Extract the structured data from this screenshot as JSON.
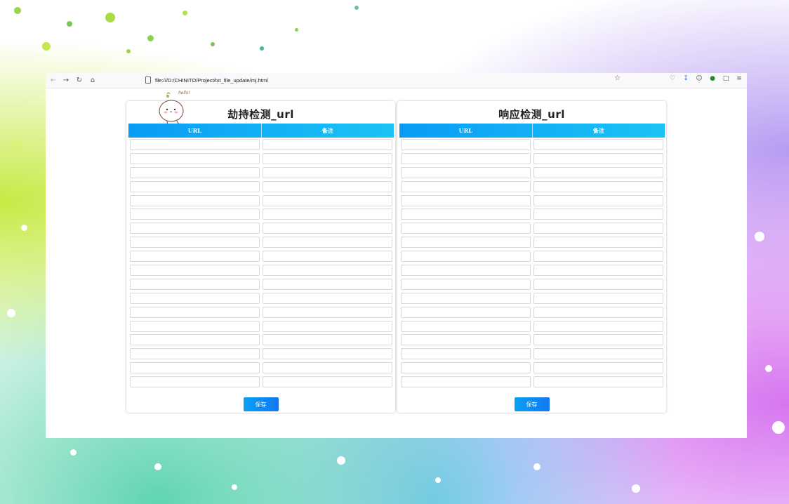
{
  "browser": {
    "url": "file:///D:/CHINITO/Project/txt_file_update/mj.html"
  },
  "mascot": {
    "greeting": "hello!"
  },
  "panels": [
    {
      "title": "劫持检测_url",
      "columns": [
        "URL",
        "备注"
      ],
      "row_count": 18,
      "save_label": "保存"
    },
    {
      "title": "响应检测_url",
      "columns": [
        "URL",
        "备注"
      ],
      "row_count": 18,
      "save_label": "保存"
    }
  ],
  "colors": {
    "header_start": "#0a9cf5",
    "header_end": "#1bc3f5",
    "button": "#0a8cf2"
  }
}
